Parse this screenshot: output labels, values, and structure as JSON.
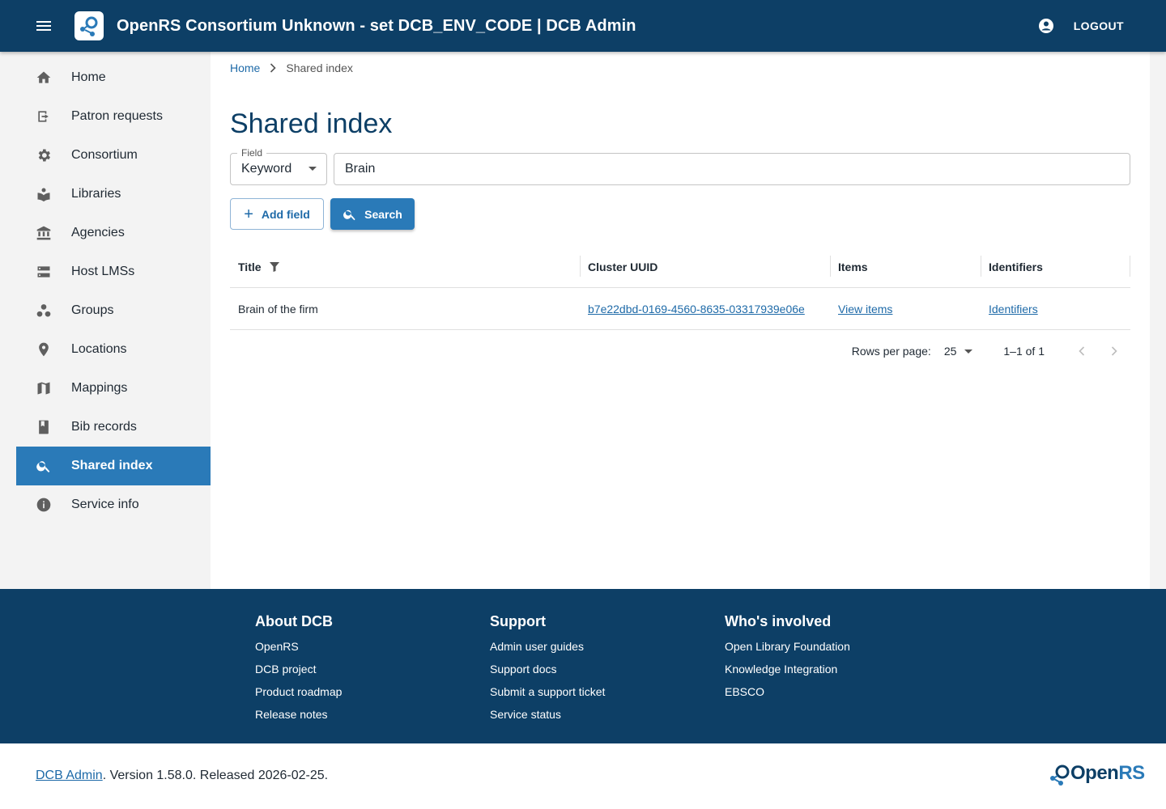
{
  "header": {
    "title": "OpenRS Consortium Unknown - set DCB_ENV_CODE | DCB Admin",
    "logout_label": "LOGOUT"
  },
  "sidebar": {
    "items": [
      {
        "label": "Home",
        "icon": "home-icon"
      },
      {
        "label": "Patron requests",
        "icon": "patron-requests-icon"
      },
      {
        "label": "Consortium",
        "icon": "gear-icon"
      },
      {
        "label": "Libraries",
        "icon": "library-icon"
      },
      {
        "label": "Agencies",
        "icon": "bank-icon"
      },
      {
        "label": "Host LMSs",
        "icon": "storage-icon"
      },
      {
        "label": "Groups",
        "icon": "groups-icon"
      },
      {
        "label": "Locations",
        "icon": "location-pin-icon"
      },
      {
        "label": "Mappings",
        "icon": "map-icon"
      },
      {
        "label": "Bib records",
        "icon": "book-icon"
      },
      {
        "label": "Shared index",
        "icon": "search-icon",
        "active": true
      },
      {
        "label": "Service info",
        "icon": "info-icon"
      }
    ]
  },
  "breadcrumb": {
    "home": "Home",
    "current": "Shared index"
  },
  "main": {
    "title": "Shared index",
    "field_legend": "Field",
    "field_value": "Keyword",
    "search_value": "Brain",
    "add_field_label": "Add field",
    "search_label": "Search"
  },
  "table": {
    "columns": [
      "Title",
      "Cluster UUID",
      "Items",
      "Identifiers"
    ],
    "rows": [
      {
        "title": "Brain of the firm",
        "cluster_uuid": "b7e22dbd-0169-4560-8635-03317939e06e",
        "items": "View items",
        "identifiers": "Identifiers"
      }
    ]
  },
  "pagination": {
    "rows_per_page_label": "Rows per page:",
    "rows_per_page": "25",
    "range": "1–1 of 1"
  },
  "footer": {
    "columns": [
      {
        "heading": "About DCB",
        "links": [
          "OpenRS",
          "DCB project",
          "Product roadmap",
          "Release notes"
        ]
      },
      {
        "heading": "Support",
        "links": [
          "Admin user guides",
          "Support docs",
          "Submit a support ticket",
          "Service status"
        ]
      },
      {
        "heading": "Who's involved",
        "links": [
          "Open Library Foundation",
          "Knowledge Integration",
          "EBSCO"
        ]
      }
    ],
    "version_link": "DCB Admin",
    "version_text": ". Version 1.58.0. Released 2026-02-25.",
    "logo_open": "Open",
    "logo_rs": "RS"
  },
  "colors": {
    "primary_dark": "#0d3f66",
    "accent": "#2a7ab8",
    "link": "#1e6aa8"
  }
}
